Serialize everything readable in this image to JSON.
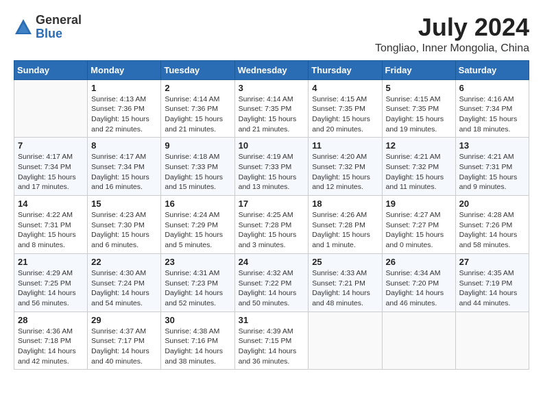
{
  "app": {
    "name_general": "General",
    "name_blue": "Blue"
  },
  "header": {
    "month_year": "July 2024",
    "location": "Tongliao, Inner Mongolia, China"
  },
  "days_of_week": [
    "Sunday",
    "Monday",
    "Tuesday",
    "Wednesday",
    "Thursday",
    "Friday",
    "Saturday"
  ],
  "weeks": [
    [
      {
        "day": "",
        "content": ""
      },
      {
        "day": "1",
        "content": "Sunrise: 4:13 AM\nSunset: 7:36 PM\nDaylight: 15 hours\nand 22 minutes."
      },
      {
        "day": "2",
        "content": "Sunrise: 4:14 AM\nSunset: 7:36 PM\nDaylight: 15 hours\nand 21 minutes."
      },
      {
        "day": "3",
        "content": "Sunrise: 4:14 AM\nSunset: 7:35 PM\nDaylight: 15 hours\nand 21 minutes."
      },
      {
        "day": "4",
        "content": "Sunrise: 4:15 AM\nSunset: 7:35 PM\nDaylight: 15 hours\nand 20 minutes."
      },
      {
        "day": "5",
        "content": "Sunrise: 4:15 AM\nSunset: 7:35 PM\nDaylight: 15 hours\nand 19 minutes."
      },
      {
        "day": "6",
        "content": "Sunrise: 4:16 AM\nSunset: 7:34 PM\nDaylight: 15 hours\nand 18 minutes."
      }
    ],
    [
      {
        "day": "7",
        "content": "Sunrise: 4:17 AM\nSunset: 7:34 PM\nDaylight: 15 hours\nand 17 minutes."
      },
      {
        "day": "8",
        "content": "Sunrise: 4:17 AM\nSunset: 7:34 PM\nDaylight: 15 hours\nand 16 minutes."
      },
      {
        "day": "9",
        "content": "Sunrise: 4:18 AM\nSunset: 7:33 PM\nDaylight: 15 hours\nand 15 minutes."
      },
      {
        "day": "10",
        "content": "Sunrise: 4:19 AM\nSunset: 7:33 PM\nDaylight: 15 hours\nand 13 minutes."
      },
      {
        "day": "11",
        "content": "Sunrise: 4:20 AM\nSunset: 7:32 PM\nDaylight: 15 hours\nand 12 minutes."
      },
      {
        "day": "12",
        "content": "Sunrise: 4:21 AM\nSunset: 7:32 PM\nDaylight: 15 hours\nand 11 minutes."
      },
      {
        "day": "13",
        "content": "Sunrise: 4:21 AM\nSunset: 7:31 PM\nDaylight: 15 hours\nand 9 minutes."
      }
    ],
    [
      {
        "day": "14",
        "content": "Sunrise: 4:22 AM\nSunset: 7:31 PM\nDaylight: 15 hours\nand 8 minutes."
      },
      {
        "day": "15",
        "content": "Sunrise: 4:23 AM\nSunset: 7:30 PM\nDaylight: 15 hours\nand 6 minutes."
      },
      {
        "day": "16",
        "content": "Sunrise: 4:24 AM\nSunset: 7:29 PM\nDaylight: 15 hours\nand 5 minutes."
      },
      {
        "day": "17",
        "content": "Sunrise: 4:25 AM\nSunset: 7:28 PM\nDaylight: 15 hours\nand 3 minutes."
      },
      {
        "day": "18",
        "content": "Sunrise: 4:26 AM\nSunset: 7:28 PM\nDaylight: 15 hours\nand 1 minute."
      },
      {
        "day": "19",
        "content": "Sunrise: 4:27 AM\nSunset: 7:27 PM\nDaylight: 15 hours\nand 0 minutes."
      },
      {
        "day": "20",
        "content": "Sunrise: 4:28 AM\nSunset: 7:26 PM\nDaylight: 14 hours\nand 58 minutes."
      }
    ],
    [
      {
        "day": "21",
        "content": "Sunrise: 4:29 AM\nSunset: 7:25 PM\nDaylight: 14 hours\nand 56 minutes."
      },
      {
        "day": "22",
        "content": "Sunrise: 4:30 AM\nSunset: 7:24 PM\nDaylight: 14 hours\nand 54 minutes."
      },
      {
        "day": "23",
        "content": "Sunrise: 4:31 AM\nSunset: 7:23 PM\nDaylight: 14 hours\nand 52 minutes."
      },
      {
        "day": "24",
        "content": "Sunrise: 4:32 AM\nSunset: 7:22 PM\nDaylight: 14 hours\nand 50 minutes."
      },
      {
        "day": "25",
        "content": "Sunrise: 4:33 AM\nSunset: 7:21 PM\nDaylight: 14 hours\nand 48 minutes."
      },
      {
        "day": "26",
        "content": "Sunrise: 4:34 AM\nSunset: 7:20 PM\nDaylight: 14 hours\nand 46 minutes."
      },
      {
        "day": "27",
        "content": "Sunrise: 4:35 AM\nSunset: 7:19 PM\nDaylight: 14 hours\nand 44 minutes."
      }
    ],
    [
      {
        "day": "28",
        "content": "Sunrise: 4:36 AM\nSunset: 7:18 PM\nDaylight: 14 hours\nand 42 minutes."
      },
      {
        "day": "29",
        "content": "Sunrise: 4:37 AM\nSunset: 7:17 PM\nDaylight: 14 hours\nand 40 minutes."
      },
      {
        "day": "30",
        "content": "Sunrise: 4:38 AM\nSunset: 7:16 PM\nDaylight: 14 hours\nand 38 minutes."
      },
      {
        "day": "31",
        "content": "Sunrise: 4:39 AM\nSunset: 7:15 PM\nDaylight: 14 hours\nand 36 minutes."
      },
      {
        "day": "",
        "content": ""
      },
      {
        "day": "",
        "content": ""
      },
      {
        "day": "",
        "content": ""
      }
    ]
  ]
}
